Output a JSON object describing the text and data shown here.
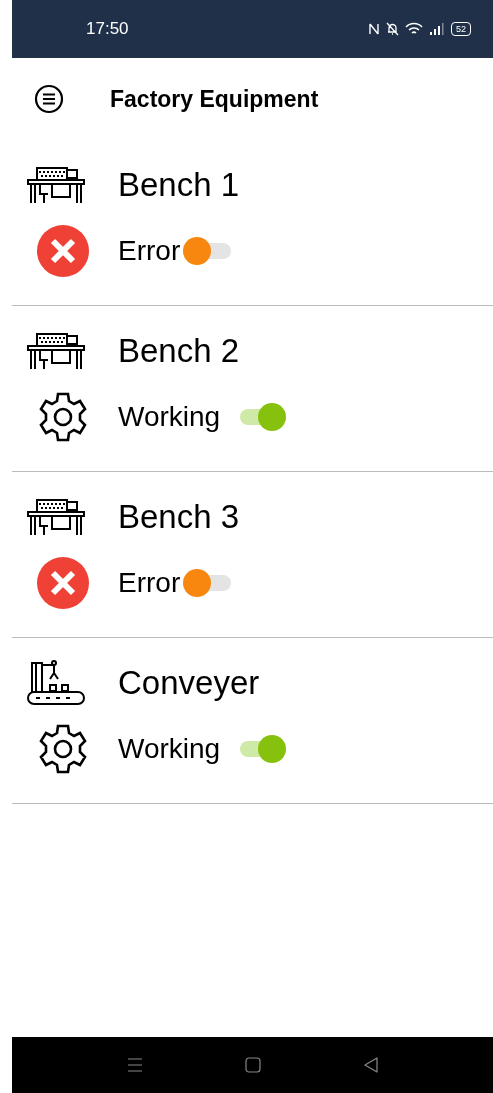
{
  "status_bar": {
    "time": "17:50",
    "battery": "52"
  },
  "app_bar": {
    "title": "Factory Equipment"
  },
  "equipment": [
    {
      "name": "Bench 1",
      "kind": "bench",
      "status": {
        "kind": "error",
        "label": "Error"
      },
      "on": false
    },
    {
      "name": "Bench 2",
      "kind": "bench",
      "status": {
        "kind": "working",
        "label": "Working"
      },
      "on": true
    },
    {
      "name": "Bench 3",
      "kind": "bench",
      "status": {
        "kind": "error",
        "label": "Error"
      },
      "on": false
    },
    {
      "name": "Conveyer",
      "kind": "conveyor",
      "status": {
        "kind": "working",
        "label": "Working"
      },
      "on": true
    }
  ]
}
